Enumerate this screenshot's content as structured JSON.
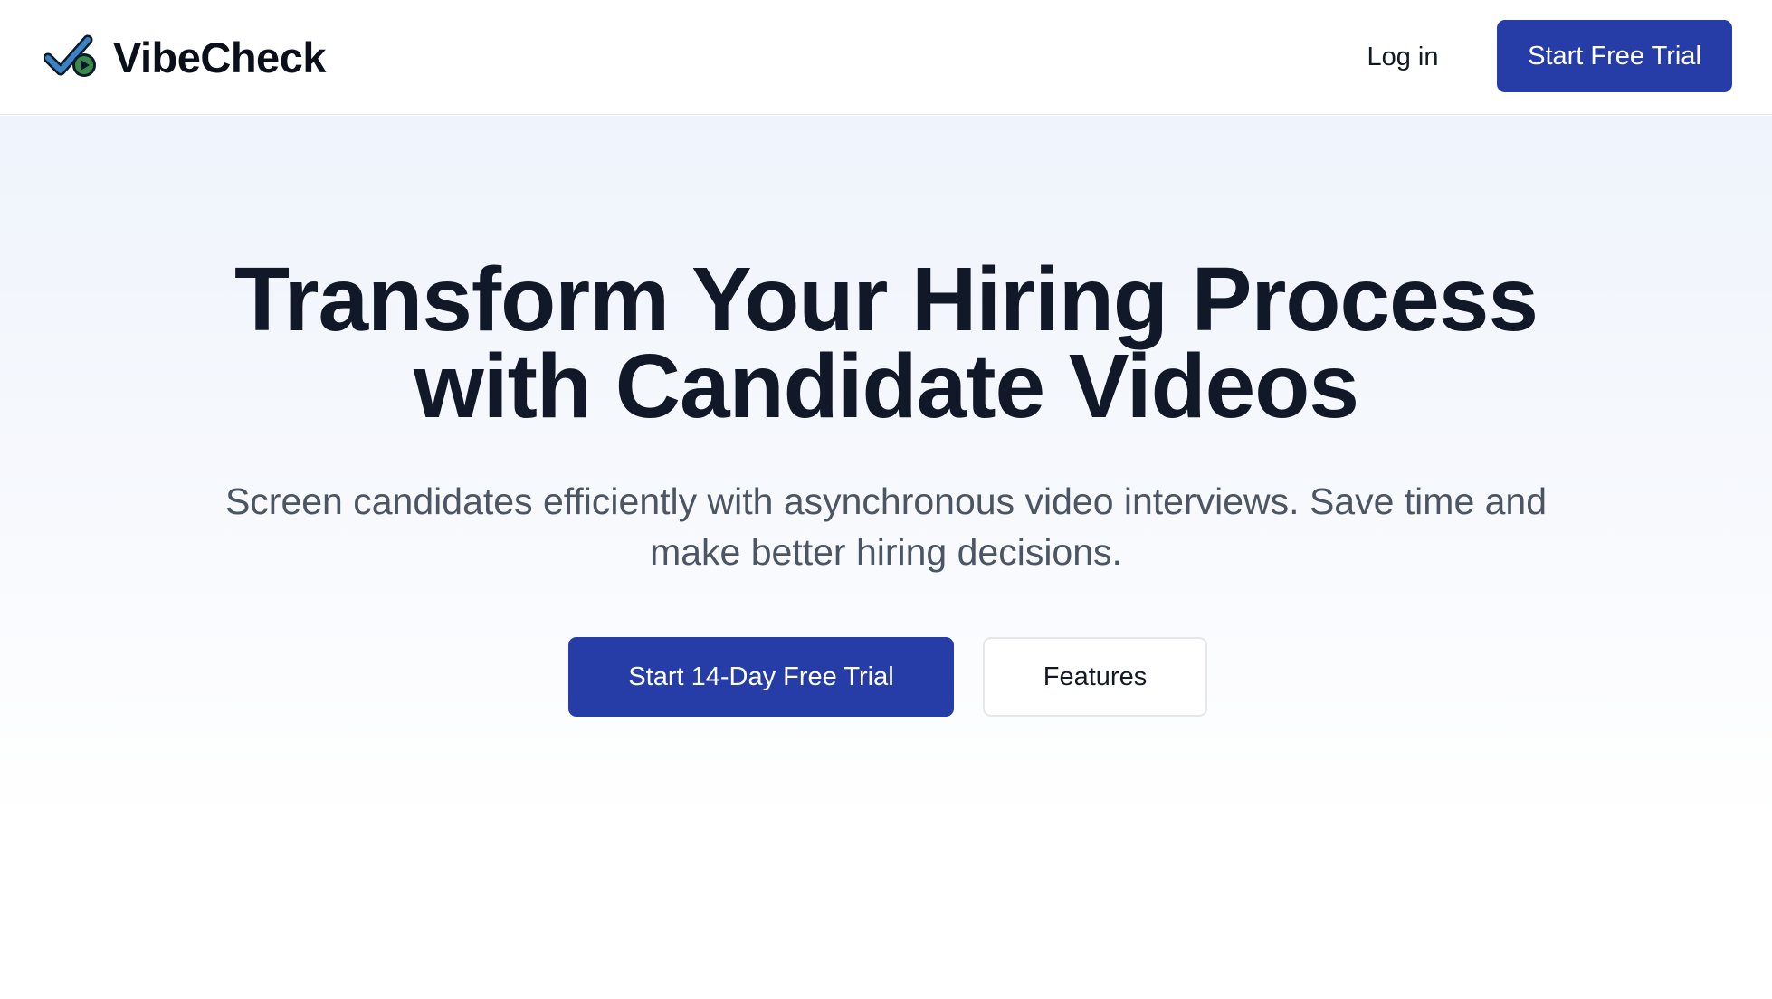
{
  "header": {
    "brand_name": "VibeCheck",
    "brand_icon": "checkmark-play-logo-icon",
    "login_label": "Log in",
    "cta_label": "Start Free Trial"
  },
  "hero": {
    "title_line1": "Transform Your Hiring Process",
    "title_line2": "with Candidate Videos",
    "subtitle_line1": "Screen candidates efficiently with asynchronous video interviews. Save time and",
    "subtitle_line2": "make better hiring decisions.",
    "primary_button_label": "Start 14-Day Free Trial",
    "secondary_button_label": "Features"
  },
  "colors": {
    "brand_primary": "#263da8",
    "logo_check_blue": "#3b82c4",
    "logo_play_green": "#3a8a4a",
    "text_dark": "#111827",
    "text_muted": "#4b5563",
    "hero_bg_top": "#eff4fc"
  }
}
